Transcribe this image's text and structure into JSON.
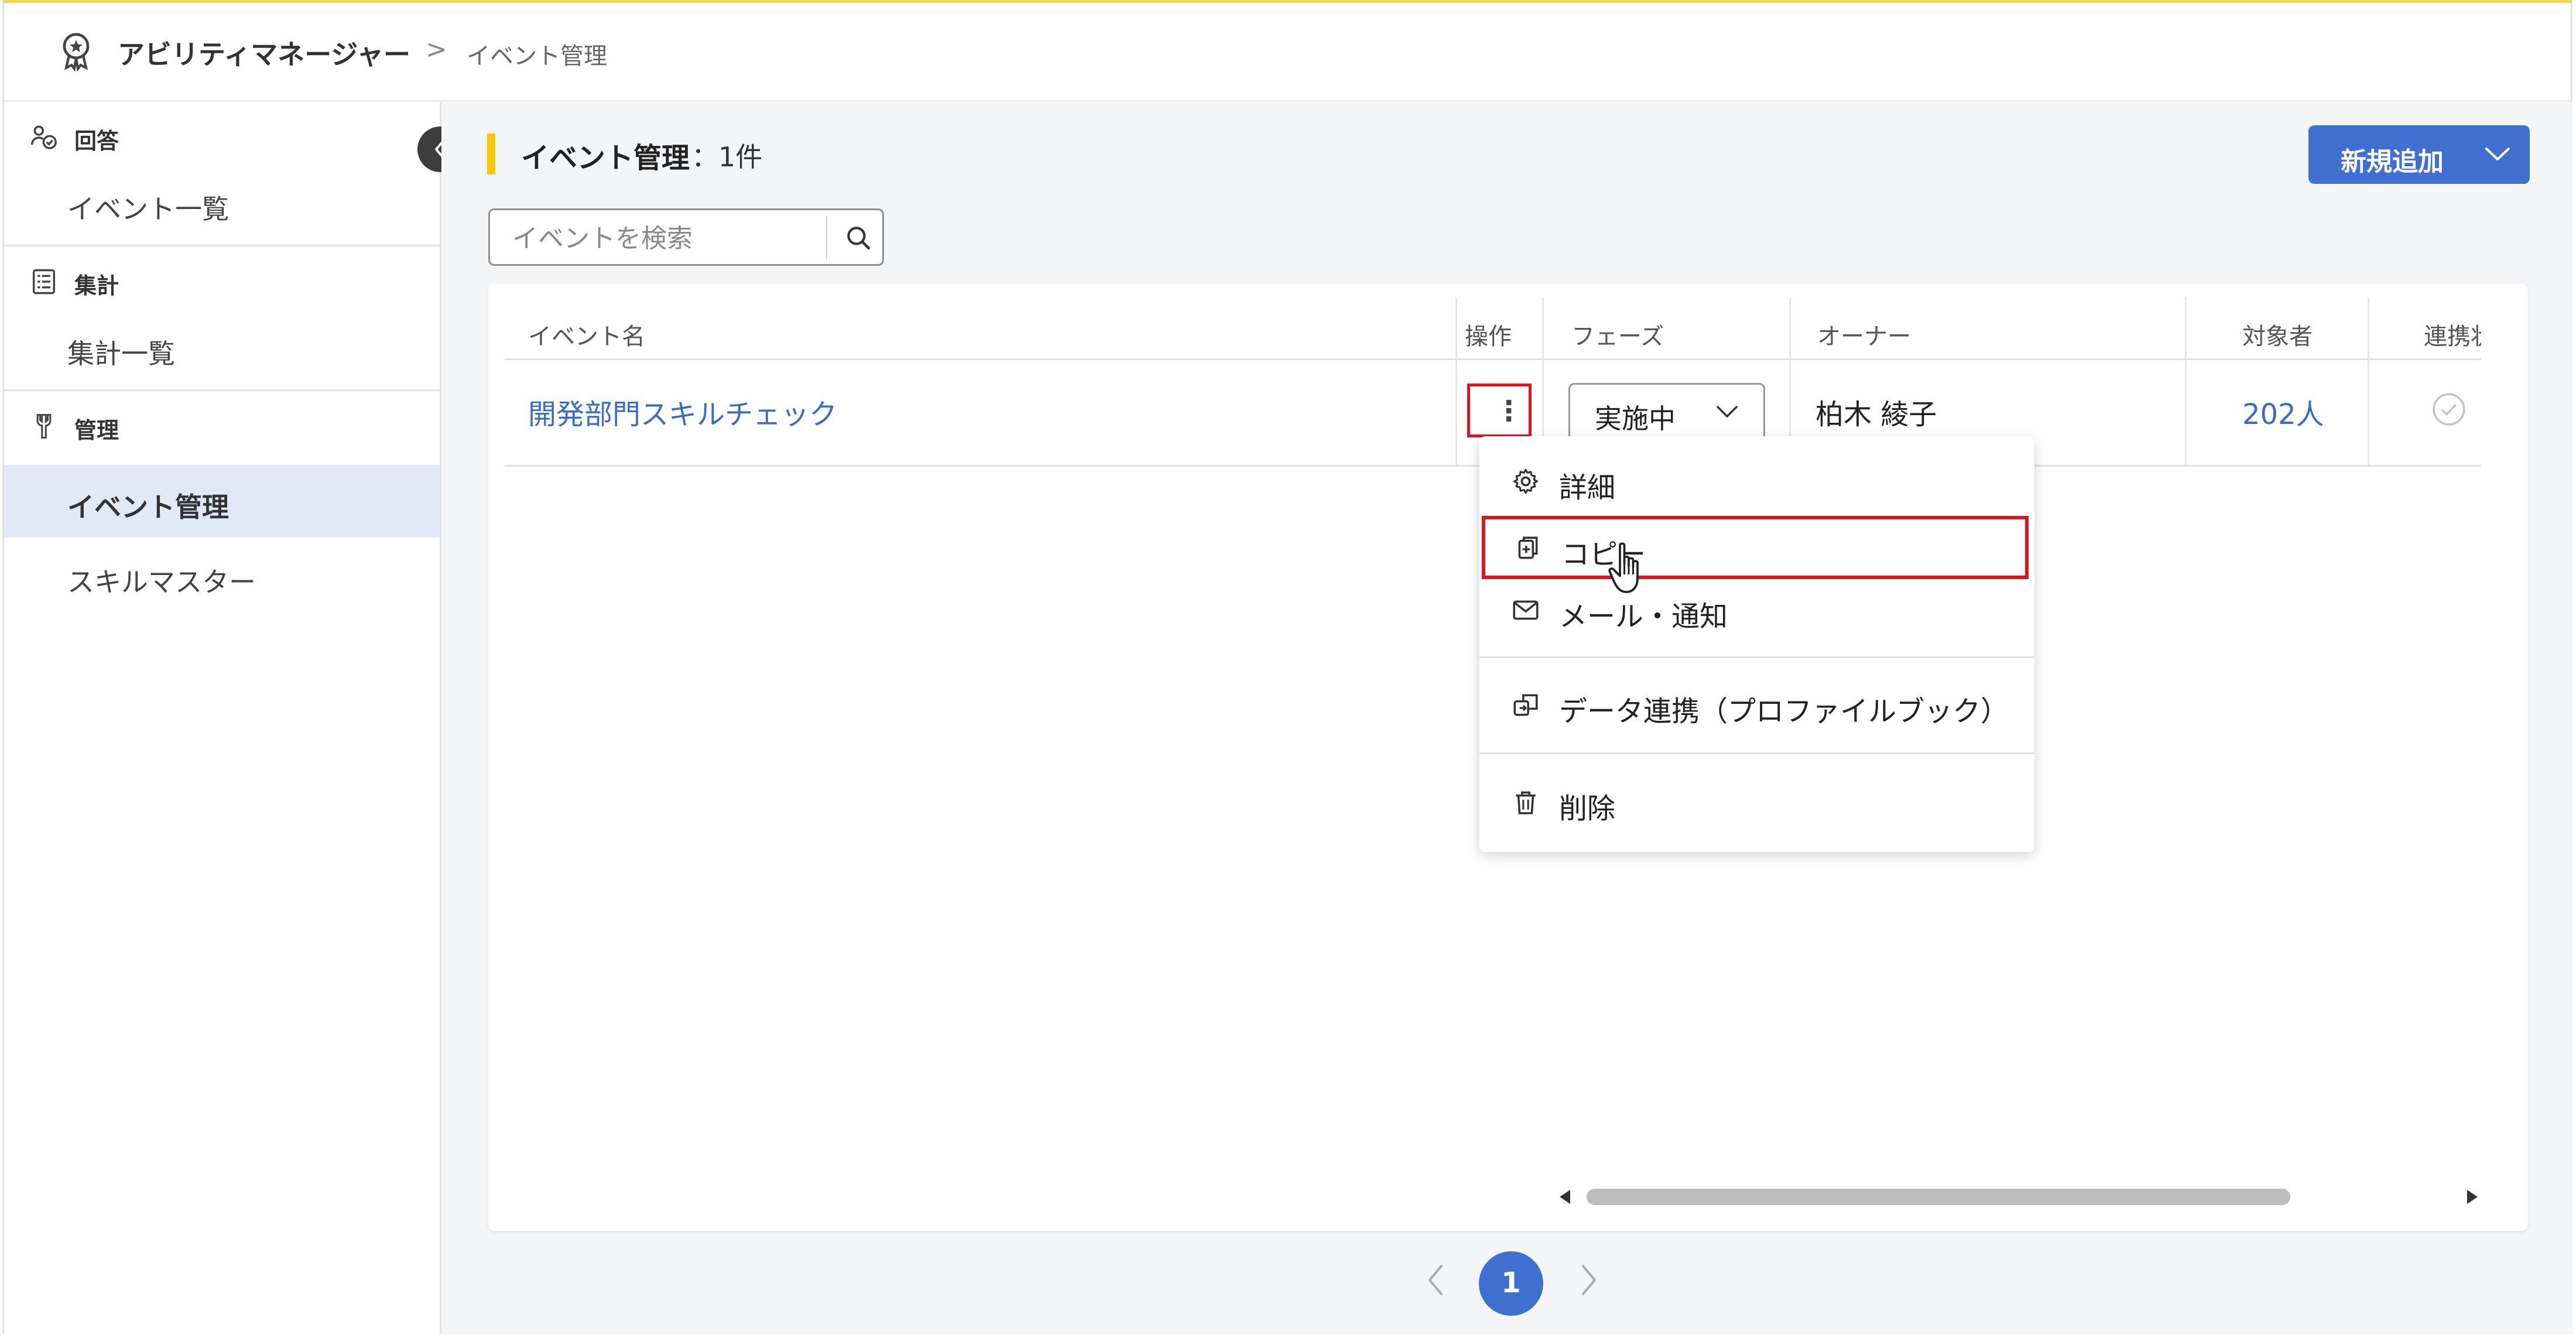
{
  "header": {
    "app_name": "アビリティマネージャー",
    "breadcrumb_separator": ">",
    "breadcrumb_current": "イベント管理"
  },
  "sidebar": {
    "sections": [
      {
        "label": "回答",
        "icon": "person-check-icon",
        "items": [
          {
            "label": "イベント一覧",
            "active": false
          }
        ]
      },
      {
        "label": "集計",
        "icon": "list-icon",
        "items": [
          {
            "label": "集計一覧",
            "active": false
          }
        ]
      },
      {
        "label": "管理",
        "icon": "wrench-icon",
        "items": [
          {
            "label": "イベント管理",
            "active": true
          },
          {
            "label": "スキルマスター",
            "active": false
          }
        ]
      }
    ]
  },
  "main": {
    "title": "イベント管理",
    "count": "：1件",
    "new_button_label": "新規追加",
    "search_placeholder": "イベントを検索",
    "table": {
      "headers": [
        "イベント名",
        "操作",
        "フェーズ",
        "オーナー",
        "対象者",
        "連携状況"
      ],
      "rows": [
        {
          "event_name": "開発部門スキルチェック",
          "ops": "⋮",
          "phase": "実施中",
          "owner": "柏木 綾子",
          "target": "202人"
        }
      ]
    },
    "pagination": {
      "current": "1"
    }
  },
  "menu": {
    "items": [
      {
        "label": "詳細",
        "icon": "gear-icon"
      },
      {
        "label": "コピー",
        "icon": "copy-icon"
      },
      {
        "label": "メール・通知",
        "icon": "mail-icon"
      },
      {
        "label": "データ連携（プロファイルブック）",
        "icon": "sync-icon"
      },
      {
        "label": "削除",
        "icon": "trash-icon"
      }
    ]
  },
  "colors": {
    "accent": "#3f6fd1",
    "link": "#3a6cc6",
    "highlight_border": "#e0141b",
    "title_bar": "#f5c800",
    "active_nav": "#e2e8f6"
  }
}
